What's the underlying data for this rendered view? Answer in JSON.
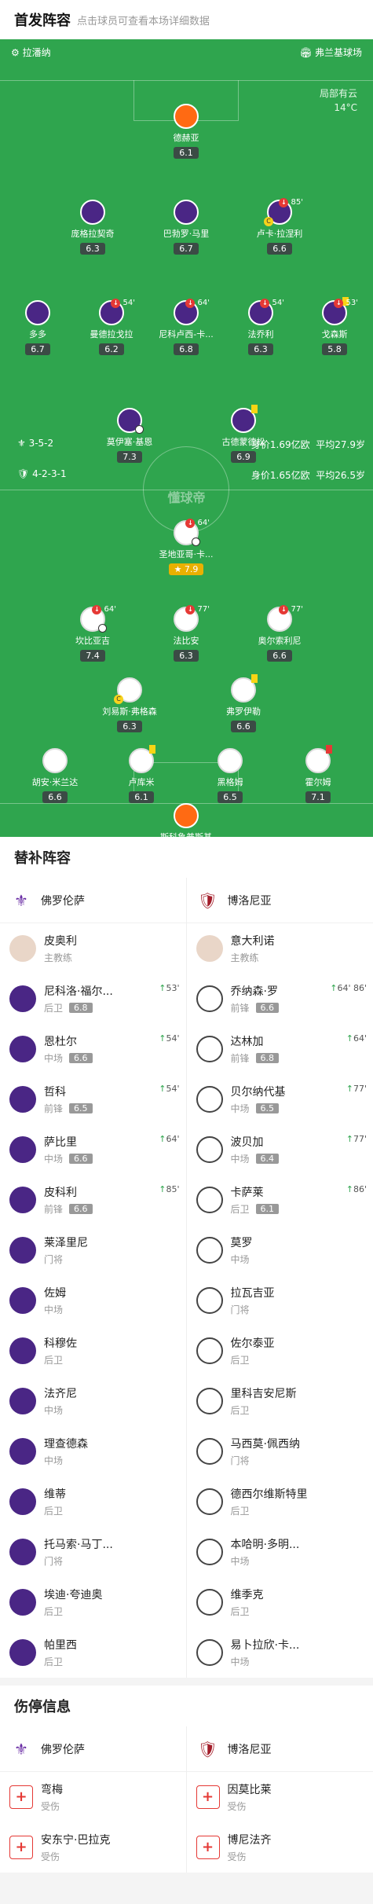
{
  "header": {
    "title": "首发阵容",
    "subtitle": "点击球员可查看本场详细数据"
  },
  "pitch": {
    "home_coach_label": "拉潘纳",
    "venue": "弗兰基球场",
    "weather": "局部有云",
    "temp": "14°C",
    "home_formation": "3-5-2",
    "away_formation": "4-2-3-1",
    "home_value": "身价1.69亿欧",
    "home_age": "平均27.9岁",
    "away_value": "身价1.65亿欧",
    "away_age": "平均26.5岁",
    "watermark": "懂球帝"
  },
  "home_players": [
    {
      "name": "德赫亚",
      "rating": "6.1",
      "sub": "",
      "gk": true
    },
    {
      "name": "庞格拉契奇",
      "rating": "6.3",
      "sub": ""
    },
    {
      "name": "巴勃罗·马里",
      "rating": "6.7",
      "sub": ""
    },
    {
      "name": "卢卡·拉涅利",
      "rating": "6.6",
      "sub": "85'"
    },
    {
      "name": "多多",
      "rating": "6.7",
      "sub": ""
    },
    {
      "name": "曼德拉戈拉",
      "rating": "6.2",
      "sub": "54'"
    },
    {
      "name": "尼科卢西-卡...",
      "rating": "6.8",
      "sub": "64'"
    },
    {
      "name": "法乔利",
      "rating": "6.3",
      "sub": "54'"
    },
    {
      "name": "戈森斯",
      "rating": "5.8",
      "sub": "53'"
    },
    {
      "name": "莫伊塞·基恩",
      "rating": "7.3",
      "sub": ""
    },
    {
      "name": "古德蒙德松",
      "rating": "6.9",
      "sub": ""
    }
  ],
  "away_players": [
    {
      "name": "圣地亚哥·卡...",
      "rating": "7.9",
      "sub": "64'"
    },
    {
      "name": "坎比亚吉",
      "rating": "7.4",
      "sub": "64'"
    },
    {
      "name": "法比安",
      "rating": "6.3",
      "sub": "77'"
    },
    {
      "name": "奥尔索利尼",
      "rating": "6.6",
      "sub": "77'"
    },
    {
      "name": "刘易斯·弗格森",
      "rating": "6.3",
      "sub": ""
    },
    {
      "name": "弗罗伊勒",
      "rating": "6.6",
      "sub": ""
    },
    {
      "name": "胡安·米兰达",
      "rating": "6.6",
      "sub": ""
    },
    {
      "name": "卢库米",
      "rating": "6.1",
      "sub": ""
    },
    {
      "name": "黑格姆",
      "rating": "6.5",
      "sub": ""
    },
    {
      "name": "霍尔姆",
      "rating": "7.1",
      "sub": ""
    },
    {
      "name": "斯科鲁普斯基",
      "rating": "6.1",
      "sub": "",
      "gk": true
    }
  ],
  "subs": {
    "title": "替补阵容",
    "home_team": "佛罗伦萨",
    "away_team": "博洛尼亚",
    "coach_label": "主教练",
    "home_coach": "皮奥利",
    "away_coach": "意大利诺",
    "home": [
      {
        "name": "尼科洛·福尔...",
        "pos": "后卫",
        "rating": "6.8",
        "ev": "53'"
      },
      {
        "name": "恩杜尔",
        "pos": "中场",
        "rating": "6.6",
        "ev": "54'"
      },
      {
        "name": "哲科",
        "pos": "前锋",
        "rating": "6.5",
        "ev": "54'"
      },
      {
        "name": "萨比里",
        "pos": "中场",
        "rating": "6.6",
        "ev": "64'"
      },
      {
        "name": "皮科利",
        "pos": "前锋",
        "rating": "6.6",
        "ev": "85'"
      },
      {
        "name": "莱泽里尼",
        "pos": "门将",
        "rating": "",
        "ev": ""
      },
      {
        "name": "佐姆",
        "pos": "中场",
        "rating": "",
        "ev": ""
      },
      {
        "name": "科穆佐",
        "pos": "后卫",
        "rating": "",
        "ev": ""
      },
      {
        "name": "法齐尼",
        "pos": "中场",
        "rating": "",
        "ev": ""
      },
      {
        "name": "理查德森",
        "pos": "中场",
        "rating": "",
        "ev": ""
      },
      {
        "name": "维蒂",
        "pos": "后卫",
        "rating": "",
        "ev": ""
      },
      {
        "name": "托马索·马丁...",
        "pos": "门将",
        "rating": "",
        "ev": ""
      },
      {
        "name": "埃迪·夸迪奥",
        "pos": "后卫",
        "rating": "",
        "ev": ""
      },
      {
        "name": "帕里西",
        "pos": "后卫",
        "rating": "",
        "ev": ""
      }
    ],
    "away": [
      {
        "name": "乔纳森·罗",
        "pos": "前锋",
        "rating": "6.6",
        "ev": "64' 86'"
      },
      {
        "name": "达林加",
        "pos": "前锋",
        "rating": "6.8",
        "ev": "64'"
      },
      {
        "name": "贝尔纳代基",
        "pos": "中场",
        "rating": "6.5",
        "ev": "77'"
      },
      {
        "name": "波贝加",
        "pos": "中场",
        "rating": "6.4",
        "ev": "77'"
      },
      {
        "name": "卡萨莱",
        "pos": "后卫",
        "rating": "6.1",
        "ev": "86'"
      },
      {
        "name": "莫罗",
        "pos": "中场",
        "rating": "",
        "ev": ""
      },
      {
        "name": "拉瓦吉亚",
        "pos": "门将",
        "rating": "",
        "ev": ""
      },
      {
        "name": "佐尔泰亚",
        "pos": "后卫",
        "rating": "",
        "ev": ""
      },
      {
        "name": "里科吉安尼斯",
        "pos": "后卫",
        "rating": "",
        "ev": ""
      },
      {
        "name": "马西莫·佩西纳",
        "pos": "门将",
        "rating": "",
        "ev": ""
      },
      {
        "name": "德西尔维斯特里",
        "pos": "后卫",
        "rating": "",
        "ev": ""
      },
      {
        "name": "本哈明·多明...",
        "pos": "中场",
        "rating": "",
        "ev": ""
      },
      {
        "name": "维季克",
        "pos": "后卫",
        "rating": "",
        "ev": ""
      },
      {
        "name": "易卜拉欣·卡...",
        "pos": "中场",
        "rating": "",
        "ev": ""
      }
    ]
  },
  "injuries": {
    "title": "伤停信息",
    "status": "受伤",
    "home": [
      "弯梅",
      "安东宁·巴拉克"
    ],
    "away": [
      "因莫比莱",
      "博尼法齐"
    ]
  }
}
